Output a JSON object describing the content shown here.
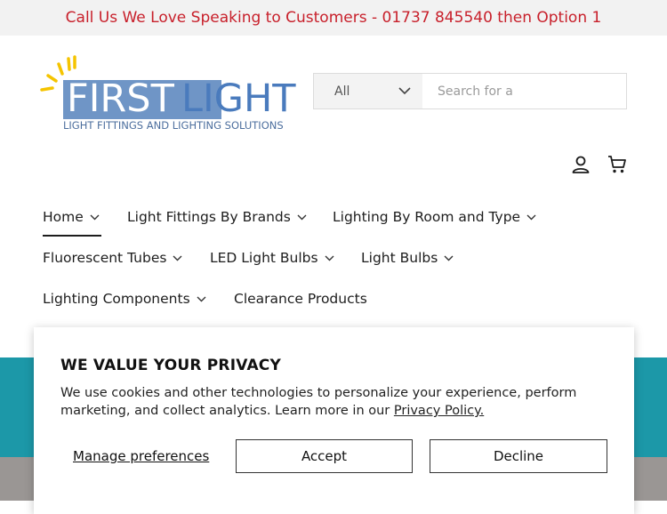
{
  "announcement": {
    "text": "Call Us We Love Speaking to Customers - 01737 845540 then Option 1"
  },
  "logo": {
    "first": "FIRST",
    "light": "LIGHT",
    "tagline": "LIGHT FITTINGS AND LIGHTING SOLUTIONS"
  },
  "search": {
    "category": "All",
    "placeholder": "Search for a"
  },
  "nav": {
    "home": "Home",
    "brands": "Light Fittings By Brands",
    "room": "Lighting By Room and Type",
    "fluorescent": "Fluorescent Tubes",
    "led": "LED Light Bulbs",
    "bulbs": "Light Bulbs",
    "components": "Lighting Components",
    "clearance": "Clearance Products"
  },
  "cookie": {
    "title": "WE VALUE YOUR PRIVACY",
    "body": "We use cookies and other technologies to personalize your experience, perform marketing, and collect analytics. Learn more in our ",
    "policy_link": "Privacy Policy.",
    "manage": "Manage preferences",
    "accept": "Accept",
    "decline": "Decline"
  },
  "colors": {
    "announcement_text": "#c8202b",
    "brand_blue": "#6f95c6",
    "teal": "#1c98a8",
    "sun_yellow": "#f5c400"
  },
  "icons": {
    "account": "account-icon",
    "cart": "cart-icon",
    "chevron": "chevron-down-icon"
  }
}
